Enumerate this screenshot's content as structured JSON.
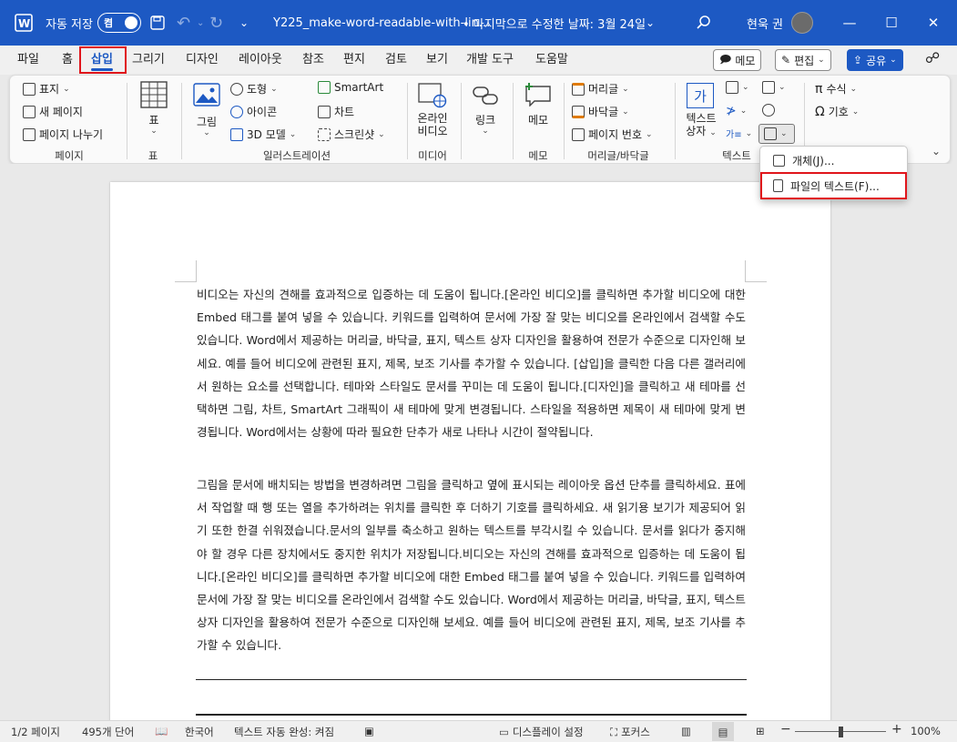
{
  "titlebar": {
    "autosave_label": "자동 저장",
    "autosave_state": "켬",
    "filename": "Y225_make-word-readable-with-lin...",
    "modified": "• 마지막으로 수정한 날짜: 3월 24일",
    "user_name": "현욱 권"
  },
  "tabs": [
    "파일",
    "홈",
    "삽입",
    "그리기",
    "디자인",
    "레이아웃",
    "참조",
    "편지",
    "검토",
    "보기",
    "개발 도구",
    "도움말"
  ],
  "actions": {
    "memo": "메모",
    "edit": "편집",
    "share": "공유"
  },
  "ribbon": {
    "page": {
      "cover": "표지",
      "blank": "새 페이지",
      "break": "페이지 나누기",
      "group": "페이지"
    },
    "table": {
      "label": "표",
      "group": "표"
    },
    "illust": {
      "picture": "그림",
      "shapes": "도형",
      "icons": "아이콘",
      "models": "3D 모델",
      "smartart": "SmartArt",
      "chart": "차트",
      "screenshot": "스크린샷",
      "group": "일러스트레이션"
    },
    "media": {
      "video_line1": "온라인",
      "video_line2": "비디오",
      "group": "미디어"
    },
    "links": {
      "link": "링크"
    },
    "comments": {
      "memo": "메모",
      "group": "메모"
    },
    "hf": {
      "header": "머리글",
      "footer": "바닥글",
      "pagenum": "페이지 번호",
      "group": "머리글/바닥글"
    },
    "text": {
      "textbox_line1": "텍스트",
      "textbox_line2": "상자",
      "glyph_ga": "가",
      "group": "텍스트"
    },
    "symbols": {
      "equation": "수식",
      "symbol": "기호"
    }
  },
  "dropdown": {
    "object": "개체(J)...",
    "text_from_file": "파일의 텍스트(F)..."
  },
  "document": {
    "para1": "비디오는 자신의 견해를 효과적으로 입증하는 데 도움이 됩니다.[온라인 비디오]를 클릭하면 추가할 비디오에 대한 Embed 태그를 붙여 넣을 수 있습니다. 키워드를 입력하여 문서에 가장 잘 맞는 비디오를 온라인에서 검색할 수도 있습니다. Word에서 제공하는 머리글, 바닥글, 표지, 텍스트 상자 디자인을 활용하여 전문가 수준으로 디자인해 보세요. 예를 들어 비디오에 관련된 표지, 제목, 보조 기사를 추가할 수 있습니다. [삽입]을 클릭한 다음 다른 갤러리에서 원하는 요소를 선택합니다. 테마와 스타일도 문서를 꾸미는 데 도움이 됩니다.[디자인]을 클릭하고 새 테마를 선택하면 그림, 차트, SmartArt 그래픽이 새 테마에 맞게 변경됩니다. 스타일을 적용하면 제목이 새 테마에 맞게 변경됩니다. Word에서는 상황에 따라 필요한 단추가 새로 나타나 시간이 절약됩니다.",
    "para2": "그림을 문서에 배치되는 방법을 변경하려면 그림을 클릭하고 옆에 표시되는 레이아웃 옵션 단추를 클릭하세요. 표에서 작업할 때 행 또는 열을 추가하려는 위치를 클릭한 후 더하기 기호를 클릭하세요. 새 읽기용 보기가 제공되어 읽기 또한 한결 쉬워졌습니다.문서의 일부를 축소하고 원하는 텍스트를 부각시킬 수 있습니다. 문서를 읽다가 중지해야 할 경우 다른 장치에서도 중지한 위치가 저장됩니다.비디오는 자신의 견해를 효과적으로 입증하는 데 도움이 됩니다.[온라인 비디오]를 클릭하면 추가할 비디오에 대한 Embed 태그를 붙여 넣을 수 있습니다. 키워드를 입력하여 문서에 가장 잘 맞는 비디오를 온라인에서 검색할 수도 있습니다. Word에서 제공하는 머리글, 바닥글, 표지, 텍스트 상자 디자인을 활용하여 전문가 수준으로 디자인해 보세요. 예를 들어 비디오에 관련된 표지, 제목, 보조 기사를 추가할 수 있습니다."
  },
  "status": {
    "page": "1/2 페이지",
    "words": "495개 단어",
    "lang": "한국어",
    "autocomplete": "텍스트 자동 완성: 켜짐",
    "display": "디스플레이 설정",
    "focus": "포커스",
    "zoom": "100%"
  },
  "colors": {
    "accent": "#1d59c3",
    "highlight": "#e0151b"
  }
}
